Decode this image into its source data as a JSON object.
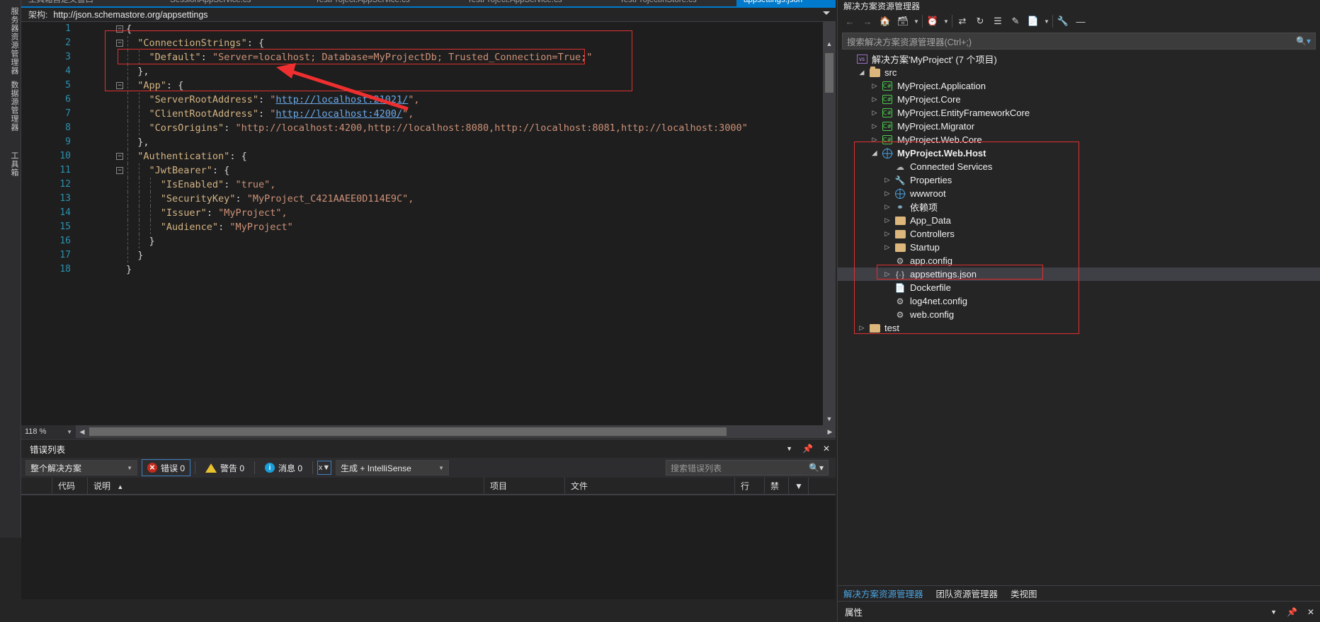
{
  "left_strip": {
    "tabs": [
      "服务器资源管理器",
      "数据源管理器",
      "工具箱"
    ]
  },
  "editor_tabs": [
    {
      "label": "工具箱自定义窗口",
      "active": false
    },
    {
      "label": "SessionAppService.cs",
      "active": false
    },
    {
      "label": "TestProject.AppService.cs",
      "active": false
    },
    {
      "label": "TestProject.AppService.cs",
      "active": false
    },
    {
      "label": "TestProjectInStore.cs",
      "active": false
    },
    {
      "label": "appsettings.json",
      "active": true
    }
  ],
  "schema": {
    "label": "架构:",
    "value": "http://json.schemastore.org/appsettings"
  },
  "code": {
    "zoom": "118 %",
    "lines": [
      {
        "n": 1,
        "fold": true,
        "indent": 0,
        "tokens": [
          {
            "t": "p",
            "v": "{"
          }
        ]
      },
      {
        "n": 2,
        "fold": true,
        "indent": 1,
        "tokens": [
          {
            "t": "k",
            "v": "\"ConnectionStrings\""
          },
          {
            "t": "p",
            "v": ": {"
          }
        ]
      },
      {
        "n": 3,
        "fold": false,
        "indent": 2,
        "tokens": [
          {
            "t": "k",
            "v": "\"Default\""
          },
          {
            "t": "p",
            "v": ": "
          },
          {
            "t": "s",
            "v": "\"Server=localhost; Database=MyProjectDb; Trusted_Connection=True;\""
          }
        ]
      },
      {
        "n": 4,
        "fold": false,
        "indent": 1,
        "tokens": [
          {
            "t": "p",
            "v": "},"
          }
        ]
      },
      {
        "n": 5,
        "fold": true,
        "indent": 1,
        "tokens": [
          {
            "t": "k",
            "v": "\"App\""
          },
          {
            "t": "p",
            "v": ": {"
          }
        ]
      },
      {
        "n": 6,
        "fold": false,
        "indent": 2,
        "tokens": [
          {
            "t": "k",
            "v": "\"ServerRootAddress\""
          },
          {
            "t": "p",
            "v": ": "
          },
          {
            "t": "s",
            "v": "\""
          },
          {
            "t": "lnk",
            "v": "http://localhost:21021/"
          },
          {
            "t": "s",
            "v": "\","
          }
        ]
      },
      {
        "n": 7,
        "fold": false,
        "indent": 2,
        "tokens": [
          {
            "t": "k",
            "v": "\"ClientRootAddress\""
          },
          {
            "t": "p",
            "v": ": "
          },
          {
            "t": "s",
            "v": "\""
          },
          {
            "t": "lnk",
            "v": "http://localhost:4200/"
          },
          {
            "t": "s",
            "v": "\","
          }
        ]
      },
      {
        "n": 8,
        "fold": false,
        "indent": 2,
        "tokens": [
          {
            "t": "k",
            "v": "\"CorsOrigins\""
          },
          {
            "t": "p",
            "v": ": "
          },
          {
            "t": "s",
            "v": "\"http://localhost:4200,http://localhost:8080,http://localhost:8081,http://localhost:3000\""
          }
        ]
      },
      {
        "n": 9,
        "fold": false,
        "indent": 1,
        "tokens": [
          {
            "t": "p",
            "v": "},"
          }
        ]
      },
      {
        "n": 10,
        "fold": true,
        "indent": 1,
        "tokens": [
          {
            "t": "k",
            "v": "\"Authentication\""
          },
          {
            "t": "p",
            "v": ": {"
          }
        ]
      },
      {
        "n": 11,
        "fold": true,
        "indent": 2,
        "tokens": [
          {
            "t": "k",
            "v": "\"JwtBearer\""
          },
          {
            "t": "p",
            "v": ": {"
          }
        ]
      },
      {
        "n": 12,
        "fold": false,
        "indent": 3,
        "tokens": [
          {
            "t": "k",
            "v": "\"IsEnabled\""
          },
          {
            "t": "p",
            "v": ": "
          },
          {
            "t": "s",
            "v": "\"true\","
          }
        ]
      },
      {
        "n": 13,
        "fold": false,
        "indent": 3,
        "tokens": [
          {
            "t": "k",
            "v": "\"SecurityKey\""
          },
          {
            "t": "p",
            "v": ": "
          },
          {
            "t": "s",
            "v": "\"MyProject_C421AAEE0D114E9C\","
          }
        ]
      },
      {
        "n": 14,
        "fold": false,
        "indent": 3,
        "tokens": [
          {
            "t": "k",
            "v": "\"Issuer\""
          },
          {
            "t": "p",
            "v": ": "
          },
          {
            "t": "s",
            "v": "\"MyProject\","
          }
        ]
      },
      {
        "n": 15,
        "fold": false,
        "indent": 3,
        "tokens": [
          {
            "t": "k",
            "v": "\"Audience\""
          },
          {
            "t": "p",
            "v": ": "
          },
          {
            "t": "s",
            "v": "\"MyProject\""
          }
        ]
      },
      {
        "n": 16,
        "fold": false,
        "indent": 2,
        "tokens": [
          {
            "t": "p",
            "v": "}"
          }
        ]
      },
      {
        "n": 17,
        "fold": false,
        "indent": 1,
        "tokens": [
          {
            "t": "p",
            "v": "}"
          }
        ]
      },
      {
        "n": 18,
        "fold": false,
        "indent": 0,
        "tokens": [
          {
            "t": "p",
            "v": "}"
          }
        ]
      }
    ]
  },
  "error_list": {
    "title": "错误列表",
    "scope_filter": "整个解决方案",
    "errors_label": "错误 0",
    "warnings_label": "警告 0",
    "messages_label": "消息 0",
    "build_filter": "生成 + IntelliSense",
    "search_placeholder": "搜索错误列表",
    "columns": [
      "",
      "代码",
      "说明",
      "项目",
      "文件",
      "行",
      "禁",
      ""
    ],
    "rows": []
  },
  "solution_explorer": {
    "title": "解决方案资源管理器",
    "search_placeholder": "搜索解决方案资源管理器(Ctrl+;)",
    "tree": [
      {
        "label": "解决方案'MyProject' (7 个项目)",
        "depth": 0,
        "icon": "solution-icon",
        "twisty": "none",
        "bold": false,
        "selected": false
      },
      {
        "label": "src",
        "depth": 1,
        "icon": "folder-open-icon",
        "twisty": "expanded",
        "bold": false,
        "selected": false
      },
      {
        "label": "MyProject.Application",
        "depth": 2,
        "icon": "csharp-project-icon",
        "twisty": "collapsed",
        "bold": false,
        "selected": false
      },
      {
        "label": "MyProject.Core",
        "depth": 2,
        "icon": "csharp-project-icon",
        "twisty": "collapsed",
        "bold": false,
        "selected": false
      },
      {
        "label": "MyProject.EntityFrameworkCore",
        "depth": 2,
        "icon": "csharp-project-icon",
        "twisty": "collapsed",
        "bold": false,
        "selected": false
      },
      {
        "label": "MyProject.Migrator",
        "depth": 2,
        "icon": "csharp-project-icon",
        "twisty": "collapsed",
        "bold": false,
        "selected": false
      },
      {
        "label": "MyProject.Web.Core",
        "depth": 2,
        "icon": "csharp-project-icon",
        "twisty": "collapsed",
        "bold": false,
        "selected": false
      },
      {
        "label": "MyProject.Web.Host",
        "depth": 2,
        "icon": "web-project-icon",
        "twisty": "expanded",
        "bold": true,
        "selected": false
      },
      {
        "label": "Connected Services",
        "depth": 3,
        "icon": "connected-services-icon",
        "twisty": "none",
        "bold": false,
        "selected": false
      },
      {
        "label": "Properties",
        "depth": 3,
        "icon": "wrench-icon",
        "twisty": "collapsed",
        "bold": false,
        "selected": false
      },
      {
        "label": "wwwroot",
        "depth": 3,
        "icon": "globe-icon",
        "twisty": "collapsed",
        "bold": false,
        "selected": false
      },
      {
        "label": "依赖项",
        "depth": 3,
        "icon": "dependencies-icon",
        "twisty": "collapsed",
        "bold": false,
        "selected": false
      },
      {
        "label": "App_Data",
        "depth": 3,
        "icon": "folder-icon",
        "twisty": "collapsed",
        "bold": false,
        "selected": false
      },
      {
        "label": "Controllers",
        "depth": 3,
        "icon": "folder-icon",
        "twisty": "collapsed",
        "bold": false,
        "selected": false
      },
      {
        "label": "Startup",
        "depth": 3,
        "icon": "folder-icon",
        "twisty": "collapsed",
        "bold": false,
        "selected": false
      },
      {
        "label": "app.config",
        "depth": 3,
        "icon": "config-file-icon",
        "twisty": "none",
        "bold": false,
        "selected": false
      },
      {
        "label": "appsettings.json",
        "depth": 3,
        "icon": "json-file-icon",
        "twisty": "collapsed",
        "bold": false,
        "selected": true
      },
      {
        "label": "Dockerfile",
        "depth": 3,
        "icon": "file-icon",
        "twisty": "none",
        "bold": false,
        "selected": false
      },
      {
        "label": "log4net.config",
        "depth": 3,
        "icon": "config-file-icon",
        "twisty": "none",
        "bold": false,
        "selected": false
      },
      {
        "label": "web.config",
        "depth": 3,
        "icon": "config-file-icon",
        "twisty": "none",
        "bold": false,
        "selected": false
      },
      {
        "label": "test",
        "depth": 1,
        "icon": "folder-icon",
        "twisty": "collapsed",
        "bold": false,
        "selected": false
      }
    ],
    "bottom_tabs": [
      {
        "label": "解决方案资源管理器",
        "active": true
      },
      {
        "label": "团队资源管理器",
        "active": false
      },
      {
        "label": "类视图",
        "active": false
      }
    ],
    "properties_title": "属性"
  },
  "colors": {
    "accent": "#007acc",
    "annotation_red": "#e03030",
    "json_key": "#d4b483",
    "json_string": "#cd9178",
    "link": "#6aa9e9",
    "line_number": "#2b91af"
  }
}
